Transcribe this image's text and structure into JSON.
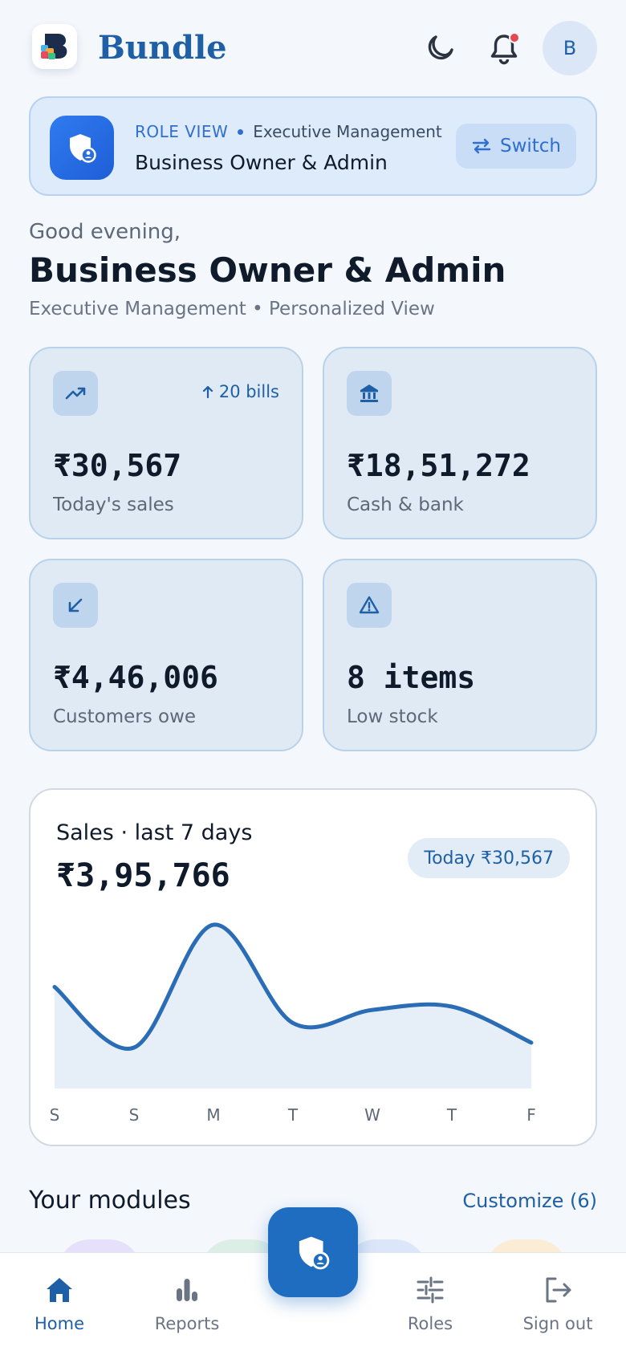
{
  "header": {
    "brand": "Bundle",
    "avatar_initial": "B"
  },
  "role_card": {
    "tag": "ROLE VIEW",
    "department": "Executive Management",
    "role": "Business Owner & Admin",
    "switch_label": "Switch"
  },
  "greeting": {
    "salutation": "Good evening,",
    "name": "Business Owner & Admin",
    "subtitle": "Executive Management • Personalized View"
  },
  "stats": [
    {
      "value": "₹30,567",
      "label": "Today's sales",
      "trend": "20 bills",
      "icon": "trend-up-icon"
    },
    {
      "value": "₹18,51,272",
      "label": "Cash & bank",
      "icon": "bank-icon"
    },
    {
      "value": "₹4,46,006",
      "label": "Customers owe",
      "icon": "arrow-down-left-icon"
    },
    {
      "value": "8 items",
      "label": "Low stock",
      "icon": "warning-icon"
    }
  ],
  "sales_card": {
    "title": "Sales · last 7 days",
    "total": "₹3,95,766",
    "today_pill": "Today ₹30,567"
  },
  "chart_data": {
    "type": "area",
    "categories": [
      "S",
      "S",
      "M",
      "T",
      "W",
      "T",
      "F"
    ],
    "values": [
      0.62,
      0.25,
      1.0,
      0.4,
      0.48,
      0.5,
      0.28
    ],
    "value_unit": "relative (no y-axis shown)",
    "xlabel": "",
    "ylabel": "",
    "grid": false,
    "line_color": "#2a6db6",
    "fill_color": "#e6eef7"
  },
  "modules": {
    "title": "Your modules",
    "customize": "Customize (6)",
    "chip_colors": [
      "#e6e0fa",
      "#dcefe6",
      "#dbe6f8",
      "#fbecd6"
    ]
  },
  "bottom_nav": {
    "items": [
      {
        "label": "Home",
        "icon": "home-icon",
        "active": true
      },
      {
        "label": "Reports",
        "icon": "bar-chart-icon",
        "active": false
      },
      {
        "label": "Roles",
        "icon": "sliders-icon",
        "active": false
      },
      {
        "label": "Sign out",
        "icon": "sign-out-icon",
        "active": false
      }
    ]
  },
  "colors": {
    "accent": "#1e5fa6",
    "background": "#f4f7fc",
    "notification": "#e5484d"
  }
}
